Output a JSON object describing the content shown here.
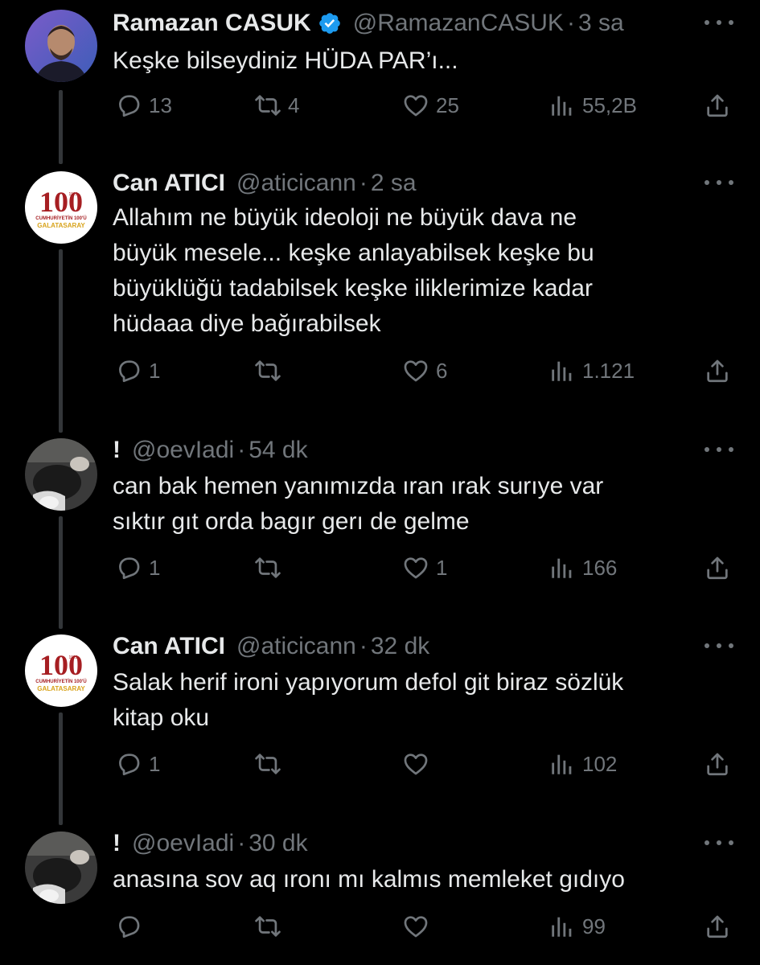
{
  "colors": {
    "background": "#000000",
    "text": "#e7e9ea",
    "muted": "#71767b",
    "verified": "#1d9bf0",
    "thread_line": "#333639"
  },
  "tweets": [
    {
      "name": "Ramazan CASUK",
      "handle": "@RamazanCASUK",
      "separator": "·",
      "time": "3 sa",
      "verified": true,
      "text": "Keşke bilseydiniz HÜDA PAR’ı...",
      "replies": "13",
      "retweets": "4",
      "likes": "25",
      "views": "55,2B",
      "avatar": "man-portrait-avatar"
    },
    {
      "name": "Can ATICI",
      "handle": "@aticicann",
      "separator": "·",
      "time": "2 sa",
      "text": "Allahım ne büyük ideoloji ne büyük dava ne\nbüyük mesele... keşke anlayabilsek keşke bu\nbüyüklüğü tadabilsek keşke iliklerimize kadar\nhüdaaa diye bağırabilsek",
      "replies": "1",
      "retweets": "",
      "likes": "6",
      "views": "1.121",
      "avatar": "galatasaray-100-logo-avatar",
      "avatar_text": {
        "big": "100",
        "small": "1923",
        "line1": "CUMHURİYETİN 100'Ü",
        "line2": "GALATASARAY"
      }
    },
    {
      "name": "!",
      "handle": "@oevIadi",
      "separator": "·",
      "time": "54 dk",
      "text": "can bak hemen yanımızda ıran ırak surıye var\nsıktır gıt orda bagır gerı de gelme",
      "replies": "1",
      "retweets": "",
      "likes": "1",
      "views": "166",
      "avatar": "photo-avatar"
    },
    {
      "name": "Can ATICI",
      "handle": "@aticicann",
      "separator": "·",
      "time": "32 dk",
      "text": "Salak herif ironi yapıyorum defol git biraz sözlük\nkitap oku",
      "replies": "1",
      "retweets": "",
      "likes": "",
      "views": "102",
      "avatar": "galatasaray-100-logo-avatar",
      "avatar_text": {
        "big": "100",
        "small": "1923",
        "line1": "CUMHURİYETİN 100'Ü",
        "line2": "GALATASARAY"
      }
    },
    {
      "name": "!",
      "handle": "@oevIadi",
      "separator": "·",
      "time": "30 dk",
      "text": "anasına sov aq ıronı mı kalmıs memleket gıdıyo",
      "replies": "",
      "retweets": "",
      "likes": "",
      "views": "99",
      "avatar": "photo-avatar"
    }
  ]
}
